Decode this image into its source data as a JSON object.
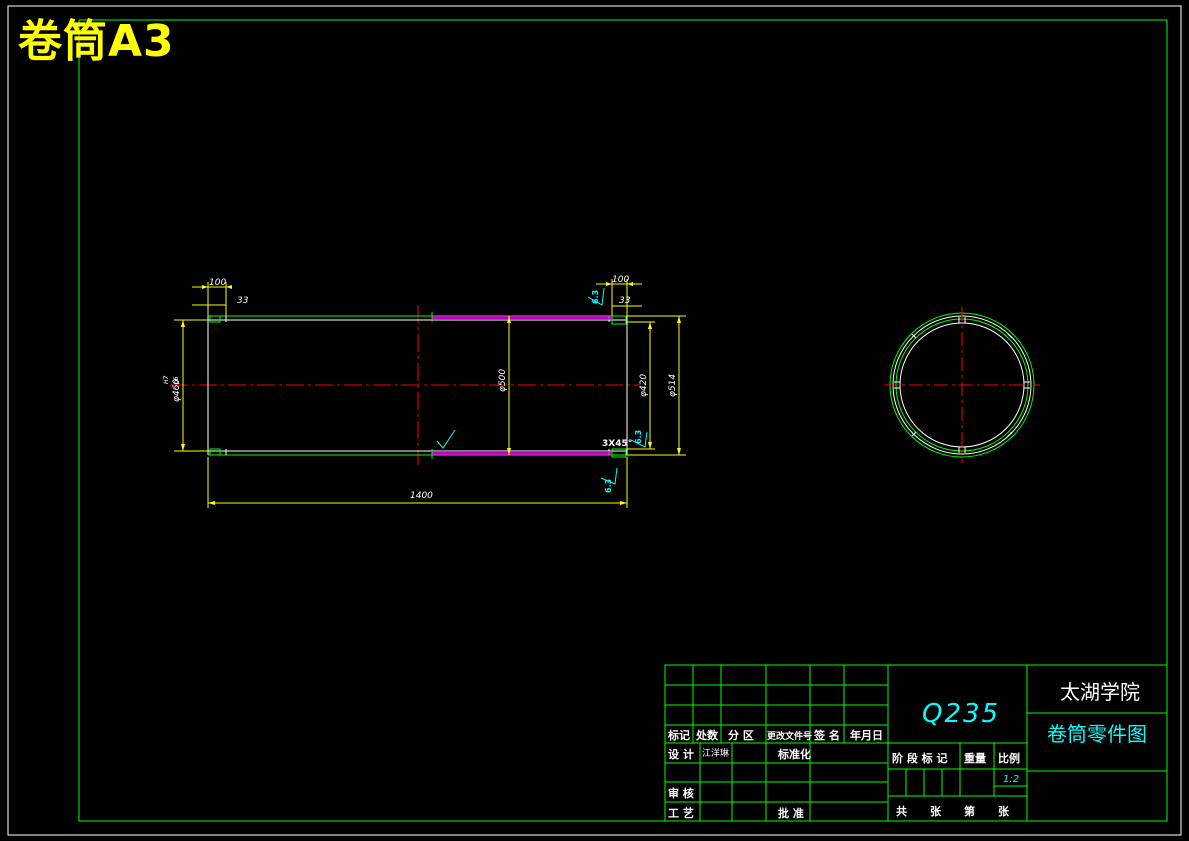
{
  "sheet_title": "卷筒A3",
  "colors": {
    "background": "#000000",
    "frame": "#ffffff",
    "border": "#00ff00",
    "dimension": "#ffff00",
    "centerline": "#ff0000",
    "hatch": "#ff00ff",
    "annotation": "#00ffff",
    "title_text": "#ffff00"
  },
  "dimensions": {
    "top_left_100": "100",
    "top_left_33": "33",
    "top_right_100": "100",
    "top_right_33": "33",
    "dia_460": "φ460",
    "dia_460_upper": "H7",
    "dia_460_lower": "p6",
    "dia_500": "φ500",
    "dia_420": "φ420",
    "dia_514": "φ514",
    "length_1400": "1400",
    "chamfer": "3X45°",
    "roughness_1": "6.3",
    "roughness_2": "6.3",
    "roughness_3": "6.3"
  },
  "title_block": {
    "material": "Q235",
    "school": "太湖学院",
    "drawing_name": "卷筒零件图",
    "hdr_mark": "标记",
    "hdr_count": "处数",
    "hdr_zone": "分 区",
    "hdr_doc": "更改文件号",
    "hdr_sign": "签 名",
    "hdr_date": "年月日",
    "design": "设 计",
    "designer": "江洋琳",
    "standardize": "标准化",
    "review": "审 核",
    "process": "工 艺",
    "approve": "批 准",
    "stage_mark": "阶 段 标 记",
    "weight": "重量",
    "scale": "比例",
    "scale_value": "1:2",
    "total_sheets": "共      张",
    "sheet_no": "第      张"
  }
}
